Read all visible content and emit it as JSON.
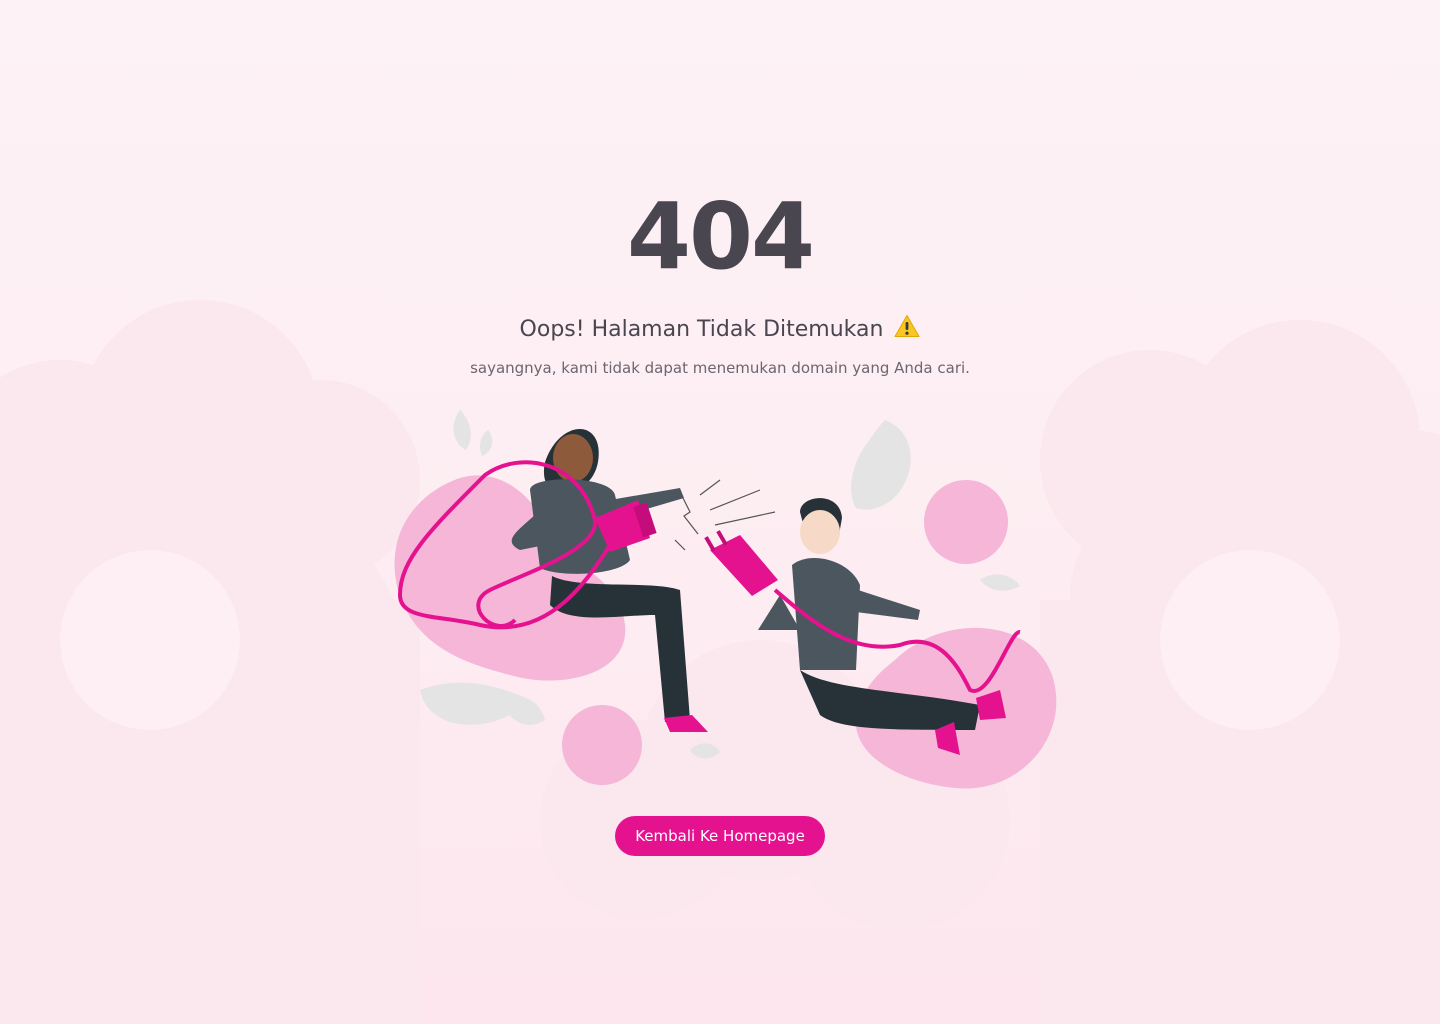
{
  "page": {
    "error_code": "404",
    "title": "Oops! Halaman Tidak Ditemukan",
    "title_icon": "warning-icon",
    "subtitle": "sayangnya, kami tidak dapat menemukan domain yang Anda cari.",
    "button_label": "Kembali Ke Homepage"
  },
  "illustration": {
    "subject": "two-people-unplugged-cable",
    "icons": [
      "plug-socket-icon",
      "plug-icon",
      "spark-icon",
      "leaf-icon"
    ]
  },
  "colors": {
    "background": "#fdf0f5",
    "cloud": "#fbe3eb",
    "text_primary": "#4a4650",
    "text_secondary": "#6b6670",
    "accent": "#e5128f",
    "blob": "#f5b6d7",
    "shirt": "#4b565e",
    "pants": "#263238"
  }
}
